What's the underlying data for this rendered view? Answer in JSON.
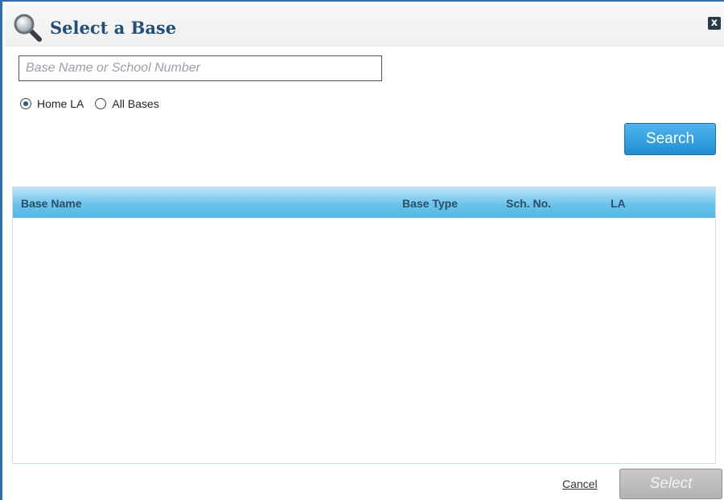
{
  "dialog": {
    "title": "Select a Base",
    "title_icon": "search-icon",
    "close_icon": "close-icon",
    "close_label": "x"
  },
  "search": {
    "placeholder": "Base Name or School Number",
    "value": "",
    "button_label": "Search"
  },
  "scope": {
    "options": [
      {
        "label": "Home LA",
        "checked": true
      },
      {
        "label": "All Bases",
        "checked": false
      }
    ]
  },
  "results": {
    "columns": [
      "Base Name",
      "Base Type",
      "Sch. No.",
      "LA"
    ],
    "rows": []
  },
  "footer": {
    "cancel_label": "Cancel",
    "select_label": "Select",
    "select_enabled": false
  },
  "colors": {
    "accent": "#1f8fd4",
    "title": "#1f4f7a",
    "header_band": "#6bc4ea",
    "disabled_button": "#b3b3b3"
  }
}
